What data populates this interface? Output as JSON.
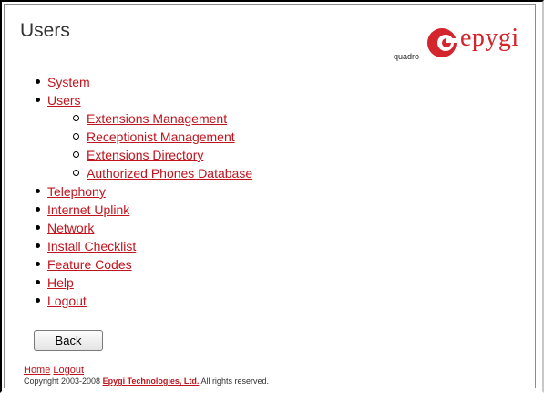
{
  "page": {
    "title": "Users"
  },
  "brand": {
    "tagline": "quadro",
    "name": "epygi",
    "color": "#d4242c",
    "icon": "epygi-logo-icon"
  },
  "menu": {
    "items": [
      {
        "label": "System"
      },
      {
        "label": "Users",
        "children": [
          {
            "label": "Extensions Management"
          },
          {
            "label": "Receptionist Management"
          },
          {
            "label": "Extensions Directory"
          },
          {
            "label": "Authorized Phones Database"
          }
        ]
      },
      {
        "label": "Telephony"
      },
      {
        "label": "Internet Uplink"
      },
      {
        "label": "Network"
      },
      {
        "label": "Install Checklist"
      },
      {
        "label": "Feature Codes"
      },
      {
        "label": "Help"
      },
      {
        "label": "Logout"
      }
    ]
  },
  "actions": {
    "back_label": "Back"
  },
  "footer": {
    "home_label": "Home",
    "logout_label": "Logout",
    "copyright_prefix": "Copyright 2003-2008",
    "company_label": "Epygi Technologies, Ltd.",
    "copyright_suffix": "All rights reserved."
  },
  "colors": {
    "link": "#c0141e",
    "title": "#333333"
  }
}
